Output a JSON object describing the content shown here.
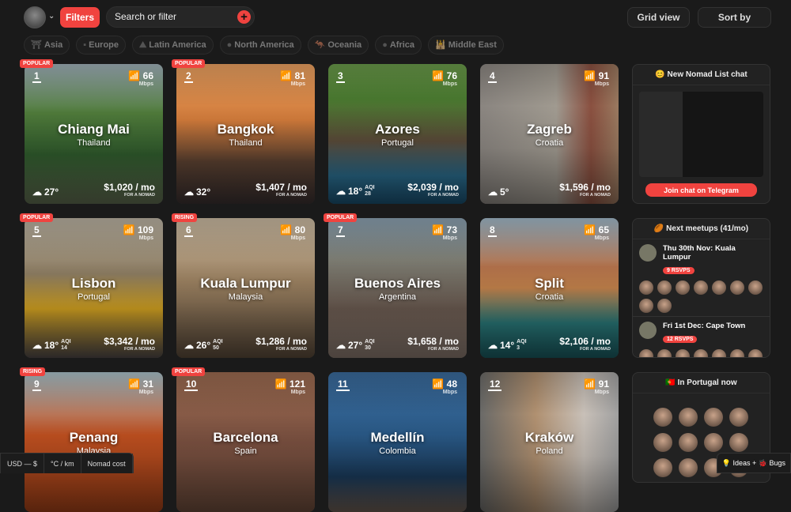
{
  "header": {
    "filters_label": "Filters",
    "search_placeholder": "Search or filter",
    "grid_view_label": "Grid view",
    "sort_by_label": "Sort by"
  },
  "regions": [
    {
      "label": "Asia",
      "icon": "⛩"
    },
    {
      "label": "Europe",
      "icon": "▪"
    },
    {
      "label": "Latin America",
      "icon": "⛰"
    },
    {
      "label": "North America",
      "icon": "●"
    },
    {
      "label": "Oceania",
      "icon": "🦘"
    },
    {
      "label": "Africa",
      "icon": "●"
    },
    {
      "label": "Middle East",
      "icon": "🕌"
    }
  ],
  "cards": [
    {
      "rank": "1",
      "badge": "POPULAR",
      "name": "Chiang Mai",
      "country": "Thailand",
      "mbps": "66",
      "temp": "27°",
      "aqi": "",
      "cost": "$1,020 / mo",
      "bg": "linear-gradient(180deg,#9fb0b8 0%,#4f7a3a 35%,#2f5a2c 65%,#5e6a50 100%)"
    },
    {
      "rank": "2",
      "badge": "POPULAR",
      "name": "Bangkok",
      "country": "Thailand",
      "mbps": "81",
      "temp": "32°",
      "aqi": "",
      "cost": "$1,407 / mo",
      "bg": "linear-gradient(180deg,#e9a060 0%,#d07a3a 40%,#5a4030 70%,#3a3030 100%)"
    },
    {
      "rank": "3",
      "badge": "",
      "name": "Azores",
      "country": "Portugal",
      "mbps": "76",
      "temp": "18°",
      "aqi": "28",
      "cost": "$2,039 / mo",
      "bg": "linear-gradient(180deg,#6a9a4a 0%,#4a7a30 25%,#5a4a38 55%,#2a6a8a 80%,#1a5070 100%)"
    },
    {
      "rank": "4",
      "badge": "",
      "name": "Zagreb",
      "country": "Croatia",
      "mbps": "91",
      "temp": "5°",
      "aqi": "",
      "cost": "$1,596 / mo",
      "bg": "linear-gradient(90deg,#8a8580 0%,#a09a90 55%,#8a5040 80%,#9a7a60 100%)"
    },
    {
      "rank": "5",
      "badge": "POPULAR",
      "name": "Lisbon",
      "country": "Portugal",
      "mbps": "109",
      "temp": "18°",
      "aqi": "14",
      "cost": "$3,342 / mo",
      "bg": "linear-gradient(180deg,#b8b0a0 0%,#8a7a60 40%,#d0a020 65%,#504a48 100%)"
    },
    {
      "rank": "6",
      "badge": "RISING",
      "name": "Kuala Lumpur",
      "country": "Malaysia",
      "mbps": "80",
      "temp": "26°",
      "aqi": "50",
      "cost": "$1,286 / mo",
      "bg": "linear-gradient(180deg,#c8b8a0 0%,#9a8060 45%,#5a4a3a 100%)"
    },
    {
      "rank": "7",
      "badge": "POPULAR",
      "name": "Buenos Aires",
      "country": "Argentina",
      "mbps": "73",
      "temp": "27°",
      "aqi": "30",
      "cost": "$1,658 / mo",
      "bg": "linear-gradient(180deg,#8aa0b0 0%,#7a7a70 30%,#6a5a50 65%,#8a7a70 100%)"
    },
    {
      "rank": "8",
      "badge": "",
      "name": "Split",
      "country": "Croatia",
      "mbps": "65",
      "temp": "14°",
      "aqi": "3",
      "cost": "$2,106 / mo",
      "bg": "linear-gradient(180deg,#a0b8c8 0%,#b0704a 35%,#c0804a 50%,#2a7a7a 75%,#1a5a60 100%)"
    },
    {
      "rank": "9",
      "badge": "RISING",
      "name": "Penang",
      "country": "Malaysia",
      "mbps": "31",
      "temp": "",
      "aqi": "",
      "cost": "",
      "bg": "linear-gradient(180deg,#a8c0c8 0%,#c05020 45%,#a04018 100%)"
    },
    {
      "rank": "10",
      "badge": "POPULAR",
      "name": "Barcelona",
      "country": "Spain",
      "mbps": "121",
      "temp": "",
      "aqi": "",
      "cost": "",
      "bg": "linear-gradient(180deg,#9a6a50 0%,#7a5040 50%,#6a4a3a 100%)"
    },
    {
      "rank": "11",
      "badge": "",
      "name": "Medellín",
      "country": "Colombia",
      "mbps": "48",
      "temp": "",
      "aqi": "",
      "cost": "",
      "bg": "linear-gradient(180deg,#3a6a9a 0%,#2a5a88 45%,#1a3a5a 75%,#6a5a50 100%)"
    },
    {
      "rank": "12",
      "badge": "",
      "name": "Kraków",
      "country": "Poland",
      "mbps": "91",
      "temp": "",
      "aqi": "",
      "cost": "",
      "bg": "linear-gradient(90deg,#6a6a68 0%,#b09070 40%,#c8c0b8 75%,#a0a0a0 100%)"
    }
  ],
  "card_labels": {
    "mbps": "Mbps",
    "aqi": "AQI",
    "for_nomad": "FOR A NOMAD"
  },
  "chat": {
    "title": "😊 New Nomad List chat",
    "button": "Join chat on Telegram"
  },
  "meetups": {
    "title": "🏉 Next meetups (41/mo)",
    "items": [
      {
        "title": "Thu 30th Nov: Kuala Lumpur",
        "rsvps": "9 RSVPS",
        "count": 9
      },
      {
        "title": "Fri 1st Dec: Cape Town",
        "rsvps": "12 RSVPS",
        "count": 12
      }
    ]
  },
  "portugal": {
    "title": "🇵🇹 In Portugal now",
    "count": 12
  },
  "footer": {
    "currency": "USD — $",
    "units": "°C / km",
    "cost": "Nomad cost",
    "feedback": "💡 Ideas + 🐞 Bugs"
  },
  "colors": {
    "accent": "#f0433f",
    "background": "#1a1a1a"
  }
}
